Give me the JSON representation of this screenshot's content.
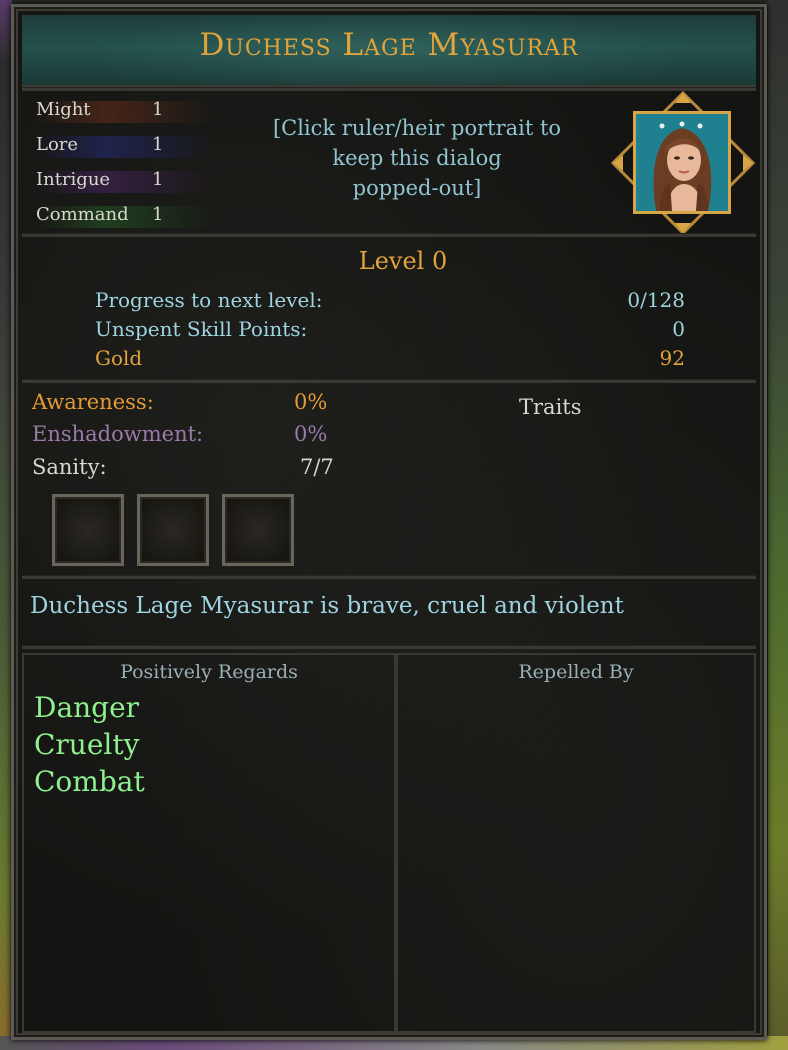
{
  "dialog": {
    "title": "Duchess Lage Myasurar"
  },
  "stats": [
    {
      "name": "Might",
      "value": "1",
      "color": "#8a3a1f"
    },
    {
      "name": "Lore",
      "value": "1",
      "color": "#2a2f8a"
    },
    {
      "name": "Intrigue",
      "value": "1",
      "color": "#5a2a7a"
    },
    {
      "name": "Command",
      "value": "1",
      "color": "#2a6a2a"
    }
  ],
  "hint": {
    "line1": "[Click ruler/heir portrait to",
    "line2": "keep this dialog",
    "line3": "popped-out]"
  },
  "level": {
    "title": "Level 0",
    "progress_label": "Progress to next level:",
    "progress_value": "0/128",
    "skill_label": "Unspent Skill Points:",
    "skill_value": "0",
    "gold_label": "Gold",
    "gold_value": "92"
  },
  "status": {
    "awareness_label": "Awareness:",
    "awareness_value": "0%",
    "enshadow_label": "Enshadowment:",
    "enshadow_value": "0%",
    "sanity_label": "Sanity:",
    "sanity_value": "7/7"
  },
  "traits_label": "Traits",
  "description": "Duchess Lage Myasurar is brave, cruel and violent",
  "regards": {
    "positive_title": "Positively Regards",
    "positive": [
      "Danger",
      "Cruelty",
      "Combat"
    ],
    "repelled_title": "Repelled By",
    "repelled": []
  },
  "colors": {
    "title": "#e2a43a",
    "hint": "#8fc4d0",
    "label_blue": "#9ed3e0",
    "awareness": "#e69a36",
    "enshadow": "#9a7aa8",
    "regard": "#8ef08e"
  }
}
